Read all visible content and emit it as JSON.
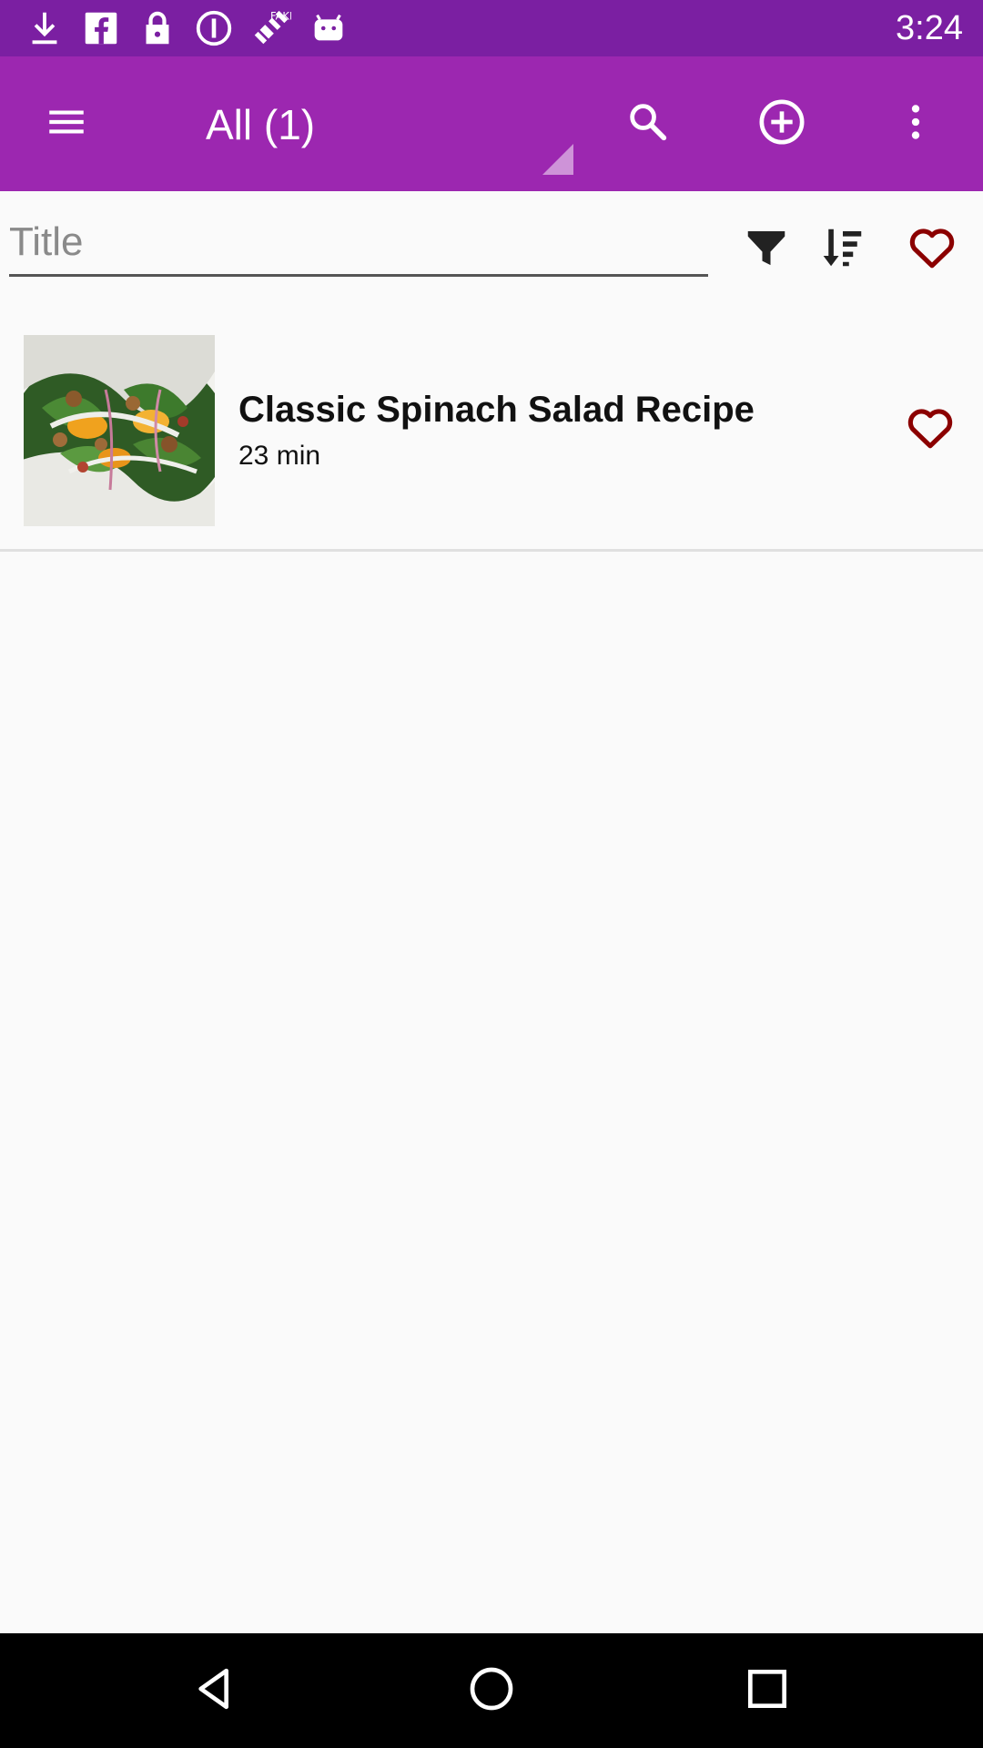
{
  "status_bar": {
    "time": "3:24",
    "icons": [
      "download-icon",
      "facebook-icon",
      "lock-icon",
      "info-circle-icon",
      "fake-gps-icon",
      "android-icon"
    ]
  },
  "app_bar": {
    "title": "All (1)",
    "icons": [
      "menu-icon",
      "search-icon",
      "add-circle-icon",
      "more-vert-icon"
    ]
  },
  "search": {
    "placeholder": "Title",
    "value": "",
    "icons": [
      "filter-icon",
      "sort-icon",
      "favorite-icon"
    ]
  },
  "recipes": [
    {
      "title": "Classic Spinach Salad Recipe",
      "time": "23 min",
      "favorite": false
    }
  ],
  "colors": {
    "status_bar": "#7b1fa2",
    "app_bar": "#9c27b0",
    "heart": "#8b0000",
    "background": "#fafafa",
    "nav_bar": "#000000"
  },
  "nav": {
    "icons": [
      "back-icon",
      "home-icon",
      "recents-icon"
    ]
  }
}
